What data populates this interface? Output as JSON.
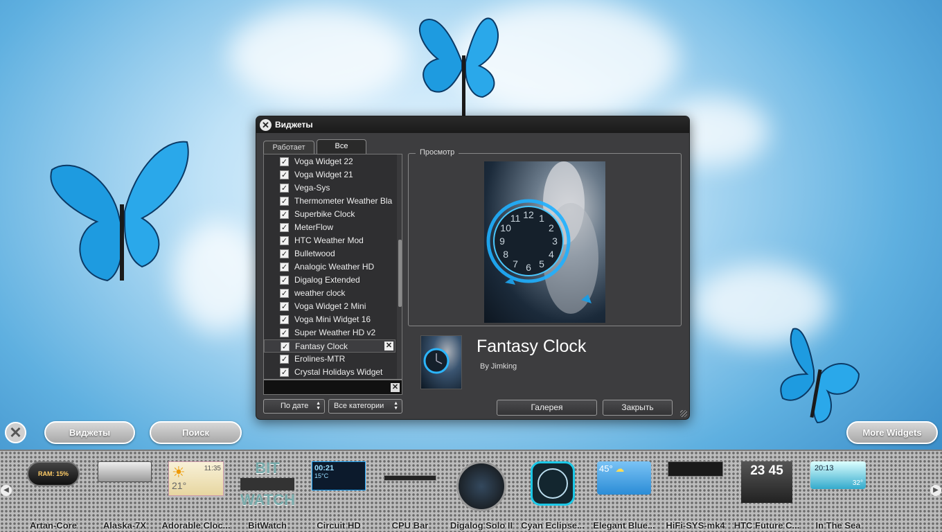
{
  "dialog": {
    "title": "Виджеты",
    "tabs": [
      "Работает",
      "Все"
    ],
    "list": [
      "Voga Widget 22",
      "Voga Widget 21",
      "Vega-Sys",
      "Thermometer Weather Bla",
      "Superbike Clock",
      "MeterFlow",
      "HTC Weather Mod",
      "Bulletwood",
      "Analogic Weather HD",
      "Digalog Extended",
      "weather clock",
      "Voga Widget 2 Mini",
      "Voga Mini Widget 16",
      "Super Weather HD v2",
      "Fantasy Clock",
      "Erolines-MTR",
      "Crystal Holidays Widget"
    ],
    "selected_index": 14,
    "sort_label": "По дате",
    "category_label": "Все категории",
    "preview_label": "Просмотр",
    "widget_name": "Fantasy Clock",
    "widget_author": "By Jimking",
    "gallery_button": "Галерея",
    "close_button": "Закрыть",
    "clock_numerals": [
      "12",
      "1",
      "2",
      "3",
      "4",
      "5",
      "6",
      "7",
      "8",
      "9",
      "10",
      "11"
    ]
  },
  "bottom": {
    "widgets_button": "Виджеты",
    "search_button": "Поиск",
    "more_button": "More Widgets"
  },
  "dock": {
    "items": [
      {
        "label": "Artan-Core",
        "icon": "artan-core-icon",
        "text": "RAM: 15%"
      },
      {
        "label": "Alaska-7X",
        "icon": "alaska-7x-icon"
      },
      {
        "label": "Adorable Cloc...",
        "icon": "adorable-clock-icon",
        "text": "11:35",
        "temp": "21°"
      },
      {
        "label": "BitWatch",
        "icon": "bitwatch-icon",
        "text": "BIT",
        "text2": "WATCH"
      },
      {
        "label": "Circuit HD",
        "icon": "circuit-hd-icon",
        "text": "00:21",
        "temp": "15°C"
      },
      {
        "label": "CPU Bar",
        "icon": "cpu-bar-icon"
      },
      {
        "label": "Digalog Solo II",
        "icon": "digalog-solo-icon"
      },
      {
        "label": "Cyan Eclipse...",
        "icon": "cyan-eclipse-icon"
      },
      {
        "label": "Elegant Blue...",
        "icon": "elegant-blue-icon",
        "temp": "45°"
      },
      {
        "label": "HiFi-SYS-mk4",
        "icon": "hifi-sys-icon"
      },
      {
        "label": "HTC Future C...",
        "icon": "htc-future-icon",
        "text": "23",
        "text2": "45"
      },
      {
        "label": "In The Sea",
        "icon": "in-the-sea-icon",
        "text": "20:13",
        "temp": "32°"
      }
    ]
  },
  "colors": {
    "sky": "#5fb0e0",
    "butterfly": "#1e9be0",
    "dialog_bg": "#3d3d3f",
    "dock_bg": "#bcbcbc"
  }
}
